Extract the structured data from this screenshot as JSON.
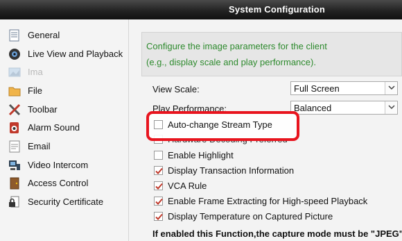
{
  "window": {
    "title": "System Configuration"
  },
  "sidebar": {
    "items": [
      {
        "label": "General",
        "icon": "general-icon"
      },
      {
        "label": "Live View and Playback",
        "icon": "camera-icon"
      },
      {
        "label": "Ima",
        "icon": "image-icon"
      },
      {
        "label": "File",
        "icon": "folder-icon"
      },
      {
        "label": "Toolbar",
        "icon": "tools-icon"
      },
      {
        "label": "Alarm Sound",
        "icon": "alarm-sound-icon"
      },
      {
        "label": "Email",
        "icon": "email-icon"
      },
      {
        "label": "Video Intercom",
        "icon": "intercom-icon"
      },
      {
        "label": "Access Control",
        "icon": "door-icon"
      },
      {
        "label": "Security Certificate",
        "icon": "certificate-icon"
      }
    ]
  },
  "content": {
    "info_line1": "Configure the image parameters for the client",
    "info_line2": "(e.g., display scale and play performance).",
    "view_scale": {
      "label": "View Scale:",
      "value": "Full Screen"
    },
    "play_performance": {
      "label": "Play Performance:",
      "value": "Balanced"
    },
    "checkboxes": [
      {
        "label": "Auto-change Stream Type",
        "checked": false
      },
      {
        "label": "Hardware Decoding Preferred",
        "checked": false
      },
      {
        "label": "Enable Highlight",
        "checked": false
      },
      {
        "label": "Display Transaction Information",
        "checked": true
      },
      {
        "label": "VCA Rule",
        "checked": true
      },
      {
        "label": "Enable Frame Extracting for High-speed Playback",
        "checked": true
      },
      {
        "label": "Display Temperature on Captured Picture",
        "checked": true
      }
    ],
    "note": "If enabled this Function,the capture mode must be \"JPEG\""
  },
  "colors": {
    "info_text": "#2d8a2d",
    "highlight": "#e8141e",
    "titlebar": "#1c1c1c"
  }
}
